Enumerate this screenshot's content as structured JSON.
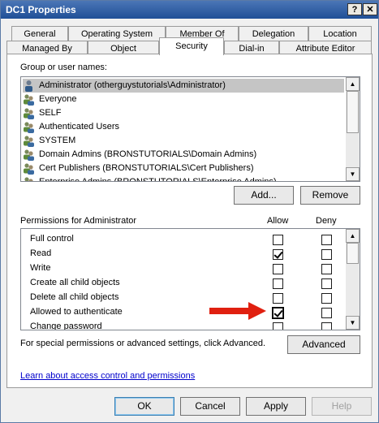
{
  "window": {
    "title": "DC1 Properties",
    "help_label": "?",
    "close_label": "✕"
  },
  "tabs_row1": [
    "General",
    "Operating System",
    "Member Of",
    "Delegation",
    "Location"
  ],
  "tabs_row2": [
    "Managed By",
    "Object",
    "Security",
    "Dial-in",
    "Attribute Editor"
  ],
  "active_tab": "Security",
  "group_label": "Group or user names:",
  "users": [
    "Administrator (otherguystutorials\\Administrator)",
    "Everyone",
    "SELF",
    "Authenticated Users",
    "SYSTEM",
    "Domain Admins (BRONSTUTORIALS\\Domain Admins)",
    "Cert Publishers (BRONSTUTORIALS\\Cert Publishers)",
    "Enterprise Admins (BRONSTUTORIALS\\Enterprise Admins)"
  ],
  "add_button": "Add...",
  "remove_button": "Remove",
  "permissions": {
    "title": "Permissions for Administrator",
    "allow_label": "Allow",
    "deny_label": "Deny",
    "rows": [
      {
        "name": "Full control",
        "allow": false,
        "deny": false
      },
      {
        "name": "Read",
        "allow": true,
        "deny": false
      },
      {
        "name": "Write",
        "allow": false,
        "deny": false
      },
      {
        "name": "Create all child objects",
        "allow": false,
        "deny": false
      },
      {
        "name": "Delete all child objects",
        "allow": false,
        "deny": false
      },
      {
        "name": "Allowed to authenticate",
        "allow": true,
        "deny": false
      },
      {
        "name": "Change password",
        "allow": false,
        "deny": false
      }
    ]
  },
  "special_text": "For special permissions or advanced settings, click Advanced.",
  "advanced_button": "Advanced",
  "learn_link": "Learn about access control and permissions",
  "footer": {
    "ok": "OK",
    "cancel": "Cancel",
    "apply": "Apply",
    "help": "Help"
  },
  "colors": {
    "titlebar": "#1f4f97",
    "arrow": "#e02010",
    "link": "#0000cc"
  },
  "icons": {
    "user": "user-icon",
    "group": "group-icon",
    "scroll_up": "scroll-up-icon",
    "scroll_down": "scroll-down-icon",
    "arrow": "red-arrow-icon"
  }
}
